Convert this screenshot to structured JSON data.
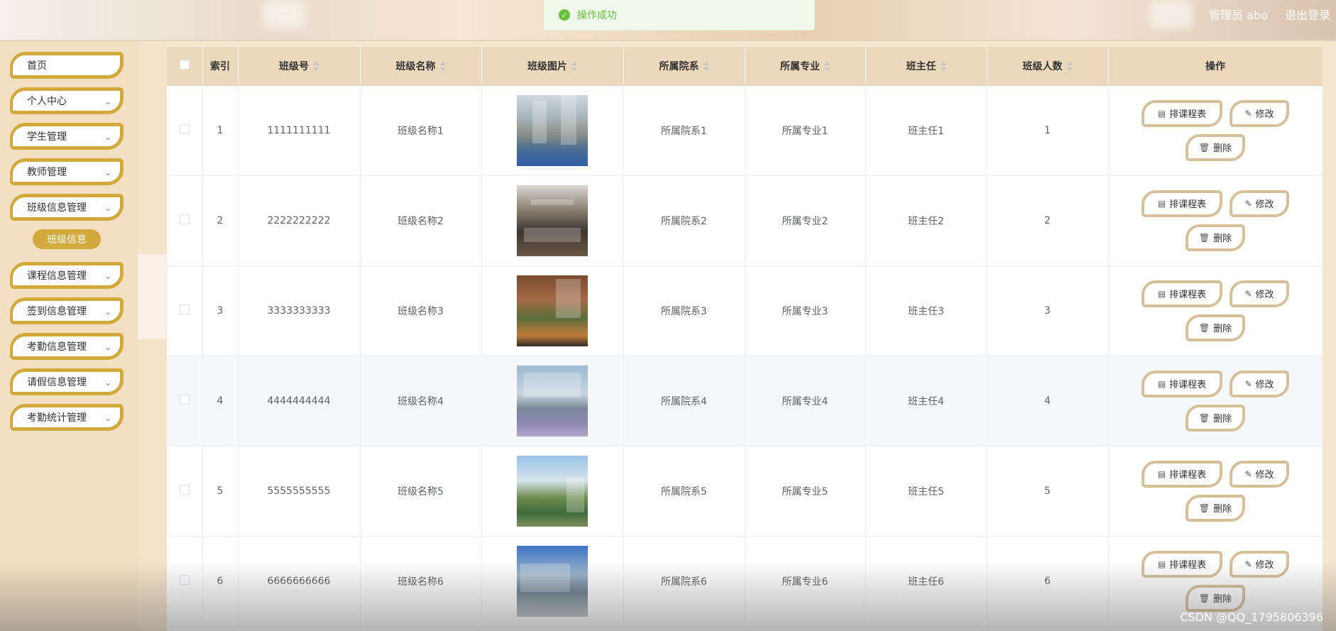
{
  "header": {
    "user_label": "管理员 abo",
    "logout_label": "退出登录"
  },
  "toast": {
    "message": "操作成功"
  },
  "sidebar": {
    "items": [
      {
        "label": "首页",
        "has_children": false
      },
      {
        "label": "个人中心",
        "has_children": true
      },
      {
        "label": "学生管理",
        "has_children": true
      },
      {
        "label": "教师管理",
        "has_children": true
      },
      {
        "label": "班级信息管理",
        "has_children": true
      },
      {
        "label": "课程信息管理",
        "has_children": true
      },
      {
        "label": "签到信息管理",
        "has_children": true
      },
      {
        "label": "考勤信息管理",
        "has_children": true
      },
      {
        "label": "请假信息管理",
        "has_children": true
      },
      {
        "label": "考勤统计管理",
        "has_children": true
      }
    ],
    "active_sub": "班级信息"
  },
  "table": {
    "columns": [
      "索引",
      "班级号",
      "班级名称",
      "班级图片",
      "所属院系",
      "所属专业",
      "班主任",
      "班级人数",
      "操作"
    ],
    "actions": {
      "schedule": "排课程表",
      "edit": "修改",
      "delete": "删除"
    },
    "rows": [
      {
        "index": "1",
        "class_no": "1111111111",
        "class_name": "班级名称1",
        "dept": "所属院系1",
        "major": "所属专业1",
        "teacher": "班主任1",
        "count": "1"
      },
      {
        "index": "2",
        "class_no": "2222222222",
        "class_name": "班级名称2",
        "dept": "所属院系2",
        "major": "所属专业2",
        "teacher": "班主任2",
        "count": "2"
      },
      {
        "index": "3",
        "class_no": "3333333333",
        "class_name": "班级名称3",
        "dept": "所属院系3",
        "major": "所属专业3",
        "teacher": "班主任3",
        "count": "3"
      },
      {
        "index": "4",
        "class_no": "4444444444",
        "class_name": "班级名称4",
        "dept": "所属院系4",
        "major": "所属专业4",
        "teacher": "班主任4",
        "count": "4"
      },
      {
        "index": "5",
        "class_no": "5555555555",
        "class_name": "班级名称5",
        "dept": "所属院系5",
        "major": "所属专业5",
        "teacher": "班主任5",
        "count": "5"
      },
      {
        "index": "6",
        "class_no": "6666666666",
        "class_name": "班级名称6",
        "dept": "所属院系6",
        "major": "所属专业6",
        "teacher": "班主任6",
        "count": "6"
      }
    ]
  },
  "watermark": "CSDN @QQ_1795806396"
}
